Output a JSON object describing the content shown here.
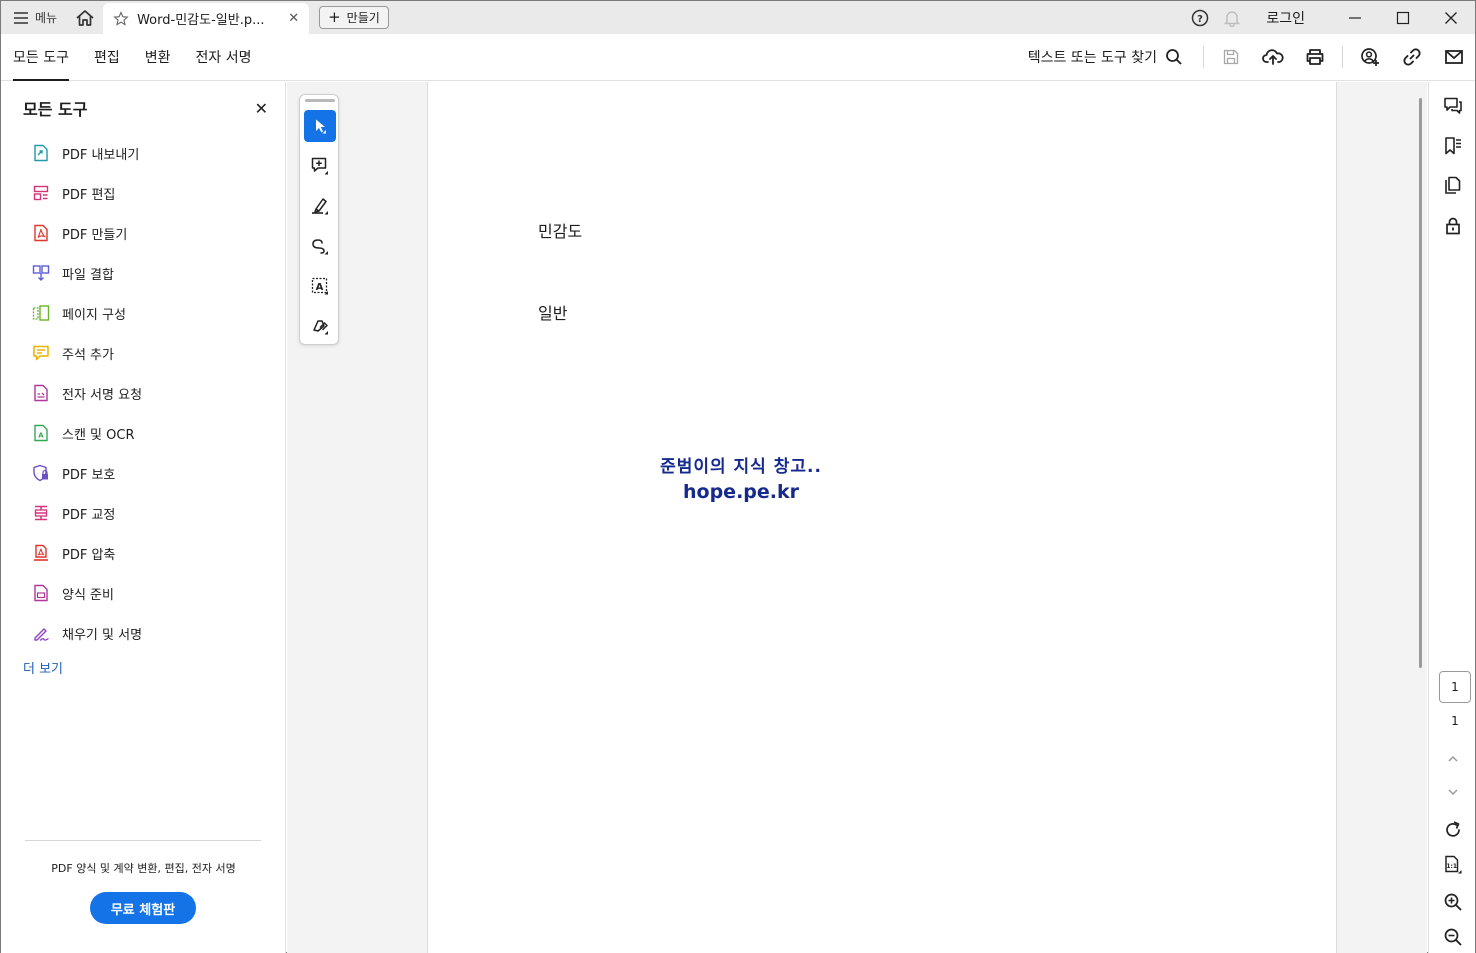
{
  "titlebar": {
    "menu_label": "메뉴",
    "tab_title": "Word-민감도-일반.p...",
    "new_button": "만들기",
    "login": "로그인"
  },
  "menubar": {
    "items": [
      "모든 도구",
      "편집",
      "변환",
      "전자 서명"
    ],
    "search_label": "텍스트 또는 도구 찾기"
  },
  "leftpanel": {
    "title": "모든 도구",
    "tools": [
      {
        "label": "PDF 내보내기",
        "icon": "export-pdf-icon",
        "color": "#1f9aa8"
      },
      {
        "label": "PDF 편집",
        "icon": "edit-pdf-icon",
        "color": "#d6337d"
      },
      {
        "label": "PDF 만들기",
        "icon": "create-pdf-icon",
        "color": "#e0342c"
      },
      {
        "label": "파일 결합",
        "icon": "combine-files-icon",
        "color": "#5a5fd6"
      },
      {
        "label": "페이지 구성",
        "icon": "organize-pages-icon",
        "color": "#6ab42b"
      },
      {
        "label": "주석 추가",
        "icon": "comment-icon",
        "color": "#e8b300"
      },
      {
        "label": "전자 서명 요청",
        "icon": "request-esign-icon",
        "color": "#b0379b"
      },
      {
        "label": "스캔 및 OCR",
        "icon": "scan-ocr-icon",
        "color": "#33a852"
      },
      {
        "label": "PDF 보호",
        "icon": "protect-pdf-icon",
        "color": "#6f4fc8"
      },
      {
        "label": "PDF 교정",
        "icon": "redact-pdf-icon",
        "color": "#d6337d"
      },
      {
        "label": "PDF 압축",
        "icon": "compress-pdf-icon",
        "color": "#e0342c"
      },
      {
        "label": "양식 준비",
        "icon": "prepare-form-icon",
        "color": "#b0379b"
      },
      {
        "label": "채우기 및 서명",
        "icon": "fill-sign-icon",
        "color": "#8d43c9"
      }
    ],
    "more_link": "더 보기",
    "promo_text": "PDF 양식 및 계약 변환, 편집, 전자 서명",
    "trial_button": "무료 체험판"
  },
  "document": {
    "line1": "민감도",
    "line2": "일반",
    "watermark_line1": "준범이의 지식 창고..",
    "watermark_line2": "hope.pe.kr"
  },
  "pagenav": {
    "current_page": "1",
    "total_pages": "1"
  },
  "colors": {
    "accent": "#1473e6",
    "watermark": "#152a8c"
  }
}
